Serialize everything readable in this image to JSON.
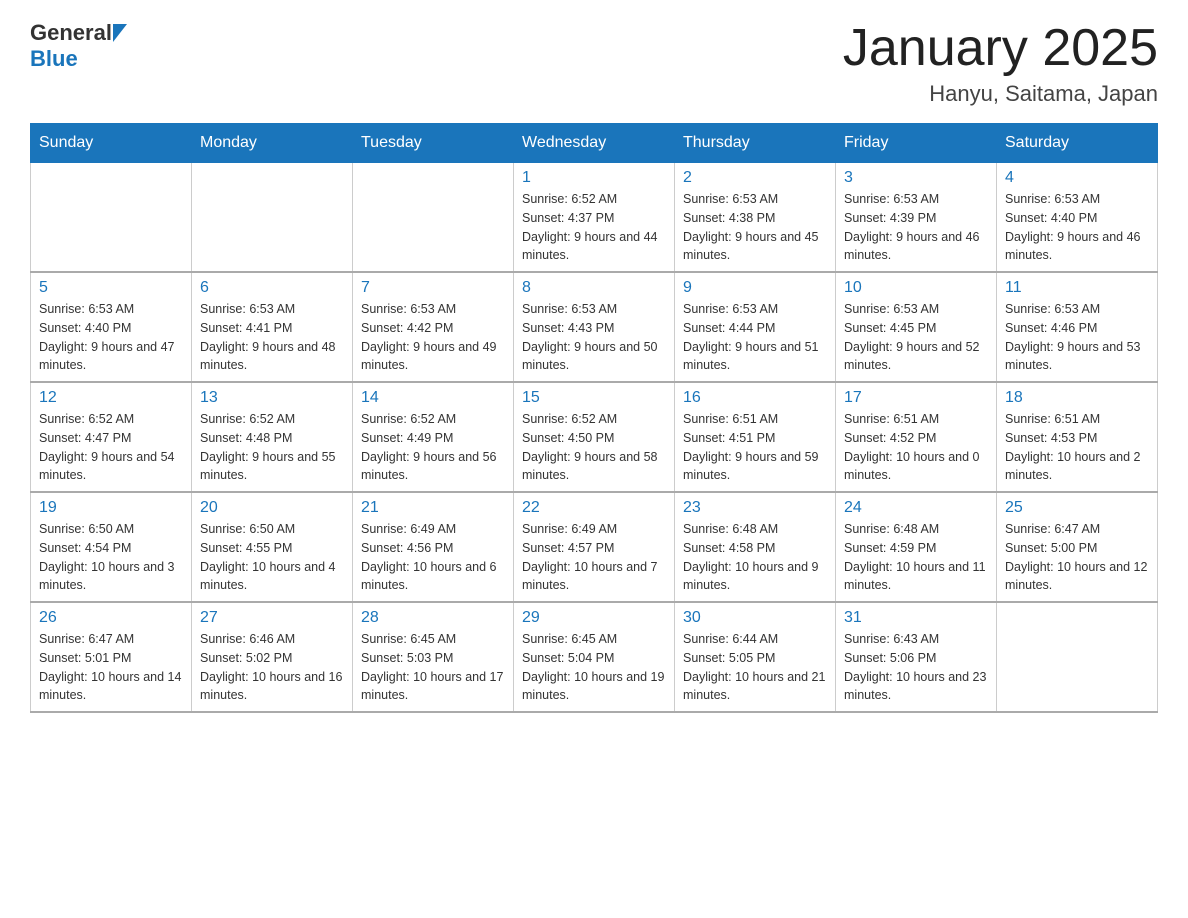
{
  "header": {
    "logo": {
      "general": "General",
      "blue": "Blue",
      "alt": "GeneralBlue logo"
    },
    "title": "January 2025",
    "subtitle": "Hanyu, Saitama, Japan"
  },
  "calendar": {
    "days_of_week": [
      "Sunday",
      "Monday",
      "Tuesday",
      "Wednesday",
      "Thursday",
      "Friday",
      "Saturday"
    ],
    "weeks": [
      [
        {
          "day": "",
          "info": ""
        },
        {
          "day": "",
          "info": ""
        },
        {
          "day": "",
          "info": ""
        },
        {
          "day": "1",
          "info": "Sunrise: 6:52 AM\nSunset: 4:37 PM\nDaylight: 9 hours and 44 minutes."
        },
        {
          "day": "2",
          "info": "Sunrise: 6:53 AM\nSunset: 4:38 PM\nDaylight: 9 hours and 45 minutes."
        },
        {
          "day": "3",
          "info": "Sunrise: 6:53 AM\nSunset: 4:39 PM\nDaylight: 9 hours and 46 minutes."
        },
        {
          "day": "4",
          "info": "Sunrise: 6:53 AM\nSunset: 4:40 PM\nDaylight: 9 hours and 46 minutes."
        }
      ],
      [
        {
          "day": "5",
          "info": "Sunrise: 6:53 AM\nSunset: 4:40 PM\nDaylight: 9 hours and 47 minutes."
        },
        {
          "day": "6",
          "info": "Sunrise: 6:53 AM\nSunset: 4:41 PM\nDaylight: 9 hours and 48 minutes."
        },
        {
          "day": "7",
          "info": "Sunrise: 6:53 AM\nSunset: 4:42 PM\nDaylight: 9 hours and 49 minutes."
        },
        {
          "day": "8",
          "info": "Sunrise: 6:53 AM\nSunset: 4:43 PM\nDaylight: 9 hours and 50 minutes."
        },
        {
          "day": "9",
          "info": "Sunrise: 6:53 AM\nSunset: 4:44 PM\nDaylight: 9 hours and 51 minutes."
        },
        {
          "day": "10",
          "info": "Sunrise: 6:53 AM\nSunset: 4:45 PM\nDaylight: 9 hours and 52 minutes."
        },
        {
          "day": "11",
          "info": "Sunrise: 6:53 AM\nSunset: 4:46 PM\nDaylight: 9 hours and 53 minutes."
        }
      ],
      [
        {
          "day": "12",
          "info": "Sunrise: 6:52 AM\nSunset: 4:47 PM\nDaylight: 9 hours and 54 minutes."
        },
        {
          "day": "13",
          "info": "Sunrise: 6:52 AM\nSunset: 4:48 PM\nDaylight: 9 hours and 55 minutes."
        },
        {
          "day": "14",
          "info": "Sunrise: 6:52 AM\nSunset: 4:49 PM\nDaylight: 9 hours and 56 minutes."
        },
        {
          "day": "15",
          "info": "Sunrise: 6:52 AM\nSunset: 4:50 PM\nDaylight: 9 hours and 58 minutes."
        },
        {
          "day": "16",
          "info": "Sunrise: 6:51 AM\nSunset: 4:51 PM\nDaylight: 9 hours and 59 minutes."
        },
        {
          "day": "17",
          "info": "Sunrise: 6:51 AM\nSunset: 4:52 PM\nDaylight: 10 hours and 0 minutes."
        },
        {
          "day": "18",
          "info": "Sunrise: 6:51 AM\nSunset: 4:53 PM\nDaylight: 10 hours and 2 minutes."
        }
      ],
      [
        {
          "day": "19",
          "info": "Sunrise: 6:50 AM\nSunset: 4:54 PM\nDaylight: 10 hours and 3 minutes."
        },
        {
          "day": "20",
          "info": "Sunrise: 6:50 AM\nSunset: 4:55 PM\nDaylight: 10 hours and 4 minutes."
        },
        {
          "day": "21",
          "info": "Sunrise: 6:49 AM\nSunset: 4:56 PM\nDaylight: 10 hours and 6 minutes."
        },
        {
          "day": "22",
          "info": "Sunrise: 6:49 AM\nSunset: 4:57 PM\nDaylight: 10 hours and 7 minutes."
        },
        {
          "day": "23",
          "info": "Sunrise: 6:48 AM\nSunset: 4:58 PM\nDaylight: 10 hours and 9 minutes."
        },
        {
          "day": "24",
          "info": "Sunrise: 6:48 AM\nSunset: 4:59 PM\nDaylight: 10 hours and 11 minutes."
        },
        {
          "day": "25",
          "info": "Sunrise: 6:47 AM\nSunset: 5:00 PM\nDaylight: 10 hours and 12 minutes."
        }
      ],
      [
        {
          "day": "26",
          "info": "Sunrise: 6:47 AM\nSunset: 5:01 PM\nDaylight: 10 hours and 14 minutes."
        },
        {
          "day": "27",
          "info": "Sunrise: 6:46 AM\nSunset: 5:02 PM\nDaylight: 10 hours and 16 minutes."
        },
        {
          "day": "28",
          "info": "Sunrise: 6:45 AM\nSunset: 5:03 PM\nDaylight: 10 hours and 17 minutes."
        },
        {
          "day": "29",
          "info": "Sunrise: 6:45 AM\nSunset: 5:04 PM\nDaylight: 10 hours and 19 minutes."
        },
        {
          "day": "30",
          "info": "Sunrise: 6:44 AM\nSunset: 5:05 PM\nDaylight: 10 hours and 21 minutes."
        },
        {
          "day": "31",
          "info": "Sunrise: 6:43 AM\nSunset: 5:06 PM\nDaylight: 10 hours and 23 minutes."
        },
        {
          "day": "",
          "info": ""
        }
      ]
    ]
  }
}
